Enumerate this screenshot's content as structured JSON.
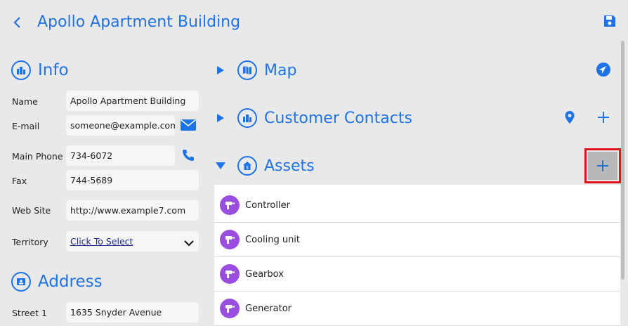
{
  "header": {
    "title": "Apollo Apartment Building"
  },
  "info": {
    "title": "Info",
    "fields": {
      "name_label": "Name",
      "name_value": "Apollo Apartment Building",
      "email_label": "E-mail",
      "email_value": "someone@example.com",
      "main_phone_label": "Main Phone",
      "main_phone_value": "734-6072",
      "fax_label": "Fax",
      "fax_value": "744-5689",
      "web_site_label": "Web Site",
      "web_site_value": "http://www.example7.com",
      "territory_label": "Territory",
      "territory_value": "Click To Select"
    }
  },
  "address": {
    "title": "Address",
    "street1_label": "Street 1",
    "street1_value": "1635 Snyder Avenue"
  },
  "sections": {
    "map": {
      "title": "Map"
    },
    "customer_contacts": {
      "title": "Customer Contacts"
    },
    "assets": {
      "title": "Assets"
    }
  },
  "assets": [
    "Controller",
    "Cooling unit",
    "Gearbox",
    "Generator"
  ],
  "colors": {
    "accent": "#1e73e8",
    "asset_avatar": "#9a4ee0",
    "highlight": "#e0141c"
  }
}
